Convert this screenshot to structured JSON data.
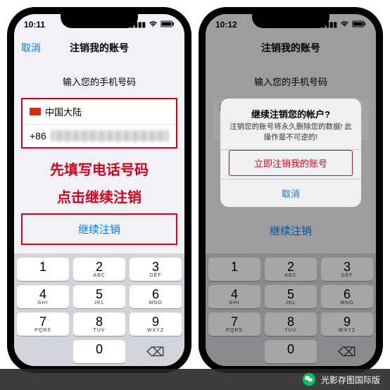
{
  "phone1": {
    "time": "10:11",
    "cancel": "取消",
    "title": "注销我的账号",
    "subtitle": "输入您的手机号码",
    "country": "中国大陆",
    "code": "+86",
    "anno1": "先填写电话号码",
    "anno2": "点击继续注销",
    "continue": "继续注销"
  },
  "phone2": {
    "time": "10:12",
    "title": "注销我的账号",
    "subtitle": "输入您的手机号码",
    "code": "+8",
    "continue": "继续注销",
    "alert": {
      "title": "继续注销您的帐户?",
      "msg": "注销您的账号将永久删除您的数据! 此操作是不可逆的!",
      "confirm": "立即注销我的账号",
      "cancel": "取消"
    }
  },
  "keypad": {
    "k1": {
      "n": "1",
      "l": ""
    },
    "k2": {
      "n": "2",
      "l": "ABC"
    },
    "k3": {
      "n": "3",
      "l": "DEF"
    },
    "k4": {
      "n": "4",
      "l": "GHI"
    },
    "k5": {
      "n": "5",
      "l": "JKL"
    },
    "k6": {
      "n": "6",
      "l": "MNO"
    },
    "k7": {
      "n": "7",
      "l": "PQRS"
    },
    "k8": {
      "n": "8",
      "l": "TUV"
    },
    "k9": {
      "n": "9",
      "l": "WXYZ"
    },
    "k0": {
      "n": "0",
      "l": ""
    },
    "del": "⌫"
  },
  "wechat": "光影存图国际版"
}
